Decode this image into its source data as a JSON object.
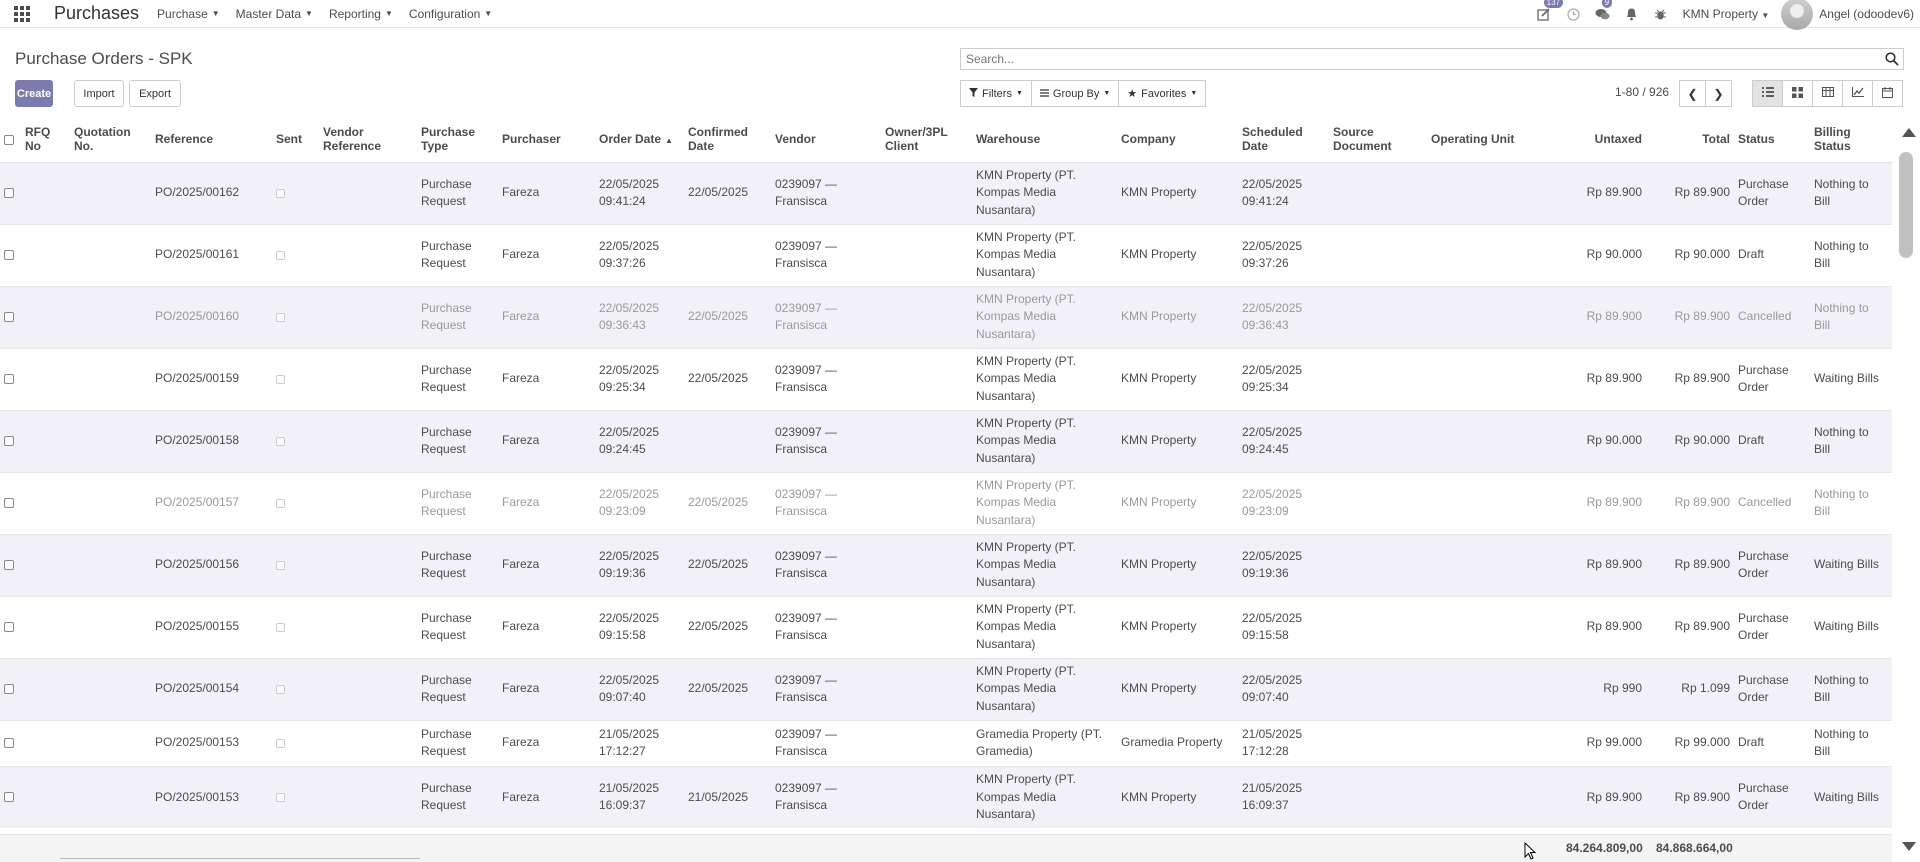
{
  "navbar": {
    "app_title": "Purchases",
    "menus": [
      "Purchase",
      "Master Data",
      "Reporting",
      "Configuration"
    ],
    "activity_badge": "137",
    "messages_badge": "9",
    "company": "KMN Property",
    "user": "Angel (odoodev6)"
  },
  "control_panel": {
    "title": "Purchase Orders - SPK",
    "create_label": "Create",
    "import_label": "Import",
    "export_label": "Export",
    "search_placeholder": "Search...",
    "filters_label": "Filters",
    "group_by_label": "Group By",
    "favorites_label": "Favorites",
    "pager": "1-80 / 926"
  },
  "table": {
    "columns": [
      "RFQ No",
      "Quotation No.",
      "Reference",
      "Sent",
      "Vendor Reference",
      "Purchase Type",
      "Purchaser",
      "Order Date",
      "Confirmed Date",
      "Vendor",
      "Owner/3PL Client",
      "Warehouse",
      "Company",
      "Scheduled Date",
      "Source Document",
      "Operating Unit",
      "Untaxed",
      "Total",
      "Status",
      "Billing Status"
    ],
    "rows": [
      {
        "ref": "PO/2025/00162",
        "ptype": "Purchase Request",
        "purchaser": "Fareza",
        "order_date": "22/05/2025 09:41:24",
        "confirmed": "22/05/2025",
        "vendor": "0239097 — Fransisca",
        "warehouse": "KMN Property (PT. Kompas Media Nusantara)",
        "company": "KMN Property",
        "scheduled": "22/05/2025 09:41:24",
        "untaxed": "Rp 89.900",
        "total": "Rp 89.900",
        "status": "Purchase Order",
        "billing": "Nothing to Bill"
      },
      {
        "ref": "PO/2025/00161",
        "ptype": "Purchase Request",
        "purchaser": "Fareza",
        "order_date": "22/05/2025 09:37:26",
        "confirmed": "",
        "vendor": "0239097 — Fransisca",
        "warehouse": "KMN Property (PT. Kompas Media Nusantara)",
        "company": "KMN Property",
        "scheduled": "22/05/2025 09:37:26",
        "untaxed": "Rp 90.000",
        "total": "Rp 90.000",
        "status": "Draft",
        "billing": "Nothing to Bill"
      },
      {
        "ref": "PO/2025/00160",
        "ptype": "Purchase Request",
        "purchaser": "Fareza",
        "order_date": "22/05/2025 09:36:43",
        "confirmed": "22/05/2025",
        "vendor": "0239097 — Fransisca",
        "warehouse": "KMN Property (PT. Kompas Media Nusantara)",
        "company": "KMN Property",
        "scheduled": "22/05/2025 09:36:43",
        "untaxed": "Rp 89.900",
        "total": "Rp 89.900",
        "status": "Cancelled",
        "billing": "Nothing to Bill"
      },
      {
        "ref": "PO/2025/00159",
        "ptype": "Purchase Request",
        "purchaser": "Fareza",
        "order_date": "22/05/2025 09:25:34",
        "confirmed": "22/05/2025",
        "vendor": "0239097 — Fransisca",
        "warehouse": "KMN Property (PT. Kompas Media Nusantara)",
        "company": "KMN Property",
        "scheduled": "22/05/2025 09:25:34",
        "untaxed": "Rp 89.900",
        "total": "Rp 89.900",
        "status": "Purchase Order",
        "billing": "Waiting Bills"
      },
      {
        "ref": "PO/2025/00158",
        "ptype": "Purchase Request",
        "purchaser": "Fareza",
        "order_date": "22/05/2025 09:24:45",
        "confirmed": "",
        "vendor": "0239097 — Fransisca",
        "warehouse": "KMN Property (PT. Kompas Media Nusantara)",
        "company": "KMN Property",
        "scheduled": "22/05/2025 09:24:45",
        "untaxed": "Rp 90.000",
        "total": "Rp 90.000",
        "status": "Draft",
        "billing": "Nothing to Bill"
      },
      {
        "ref": "PO/2025/00157",
        "ptype": "Purchase Request",
        "purchaser": "Fareza",
        "order_date": "22/05/2025 09:23:09",
        "confirmed": "22/05/2025",
        "vendor": "0239097 — Fransisca",
        "warehouse": "KMN Property (PT. Kompas Media Nusantara)",
        "company": "KMN Property",
        "scheduled": "22/05/2025 09:23:09",
        "untaxed": "Rp 89.900",
        "total": "Rp 89.900",
        "status": "Cancelled",
        "billing": "Nothing to Bill"
      },
      {
        "ref": "PO/2025/00156",
        "ptype": "Purchase Request",
        "purchaser": "Fareza",
        "order_date": "22/05/2025 09:19:36",
        "confirmed": "22/05/2025",
        "vendor": "0239097 — Fransisca",
        "warehouse": "KMN Property (PT. Kompas Media Nusantara)",
        "company": "KMN Property",
        "scheduled": "22/05/2025 09:19:36",
        "untaxed": "Rp 89.900",
        "total": "Rp 89.900",
        "status": "Purchase Order",
        "billing": "Waiting Bills"
      },
      {
        "ref": "PO/2025/00155",
        "ptype": "Purchase Request",
        "purchaser": "Fareza",
        "order_date": "22/05/2025 09:15:58",
        "confirmed": "22/05/2025",
        "vendor": "0239097 — Fransisca",
        "warehouse": "KMN Property (PT. Kompas Media Nusantara)",
        "company": "KMN Property",
        "scheduled": "22/05/2025 09:15:58",
        "untaxed": "Rp 89.900",
        "total": "Rp 89.900",
        "status": "Purchase Order",
        "billing": "Waiting Bills"
      },
      {
        "ref": "PO/2025/00154",
        "ptype": "Purchase Request",
        "purchaser": "Fareza",
        "order_date": "22/05/2025 09:07:40",
        "confirmed": "22/05/2025",
        "vendor": "0239097 — Fransisca",
        "warehouse": "KMN Property (PT. Kompas Media Nusantara)",
        "company": "KMN Property",
        "scheduled": "22/05/2025 09:07:40",
        "untaxed": "Rp 990",
        "total": "Rp 1.099",
        "status": "Purchase Order",
        "billing": "Nothing to Bill"
      },
      {
        "ref": "PO/2025/00153",
        "ptype": "Purchase Request",
        "purchaser": "Fareza",
        "order_date": "21/05/2025 17:12:27",
        "confirmed": "",
        "vendor": "0239097 — Fransisca",
        "warehouse": "Gramedia Property (PT. Gramedia)",
        "company": "Gramedia Property",
        "scheduled": "21/05/2025 17:12:28",
        "untaxed": "Rp 99.000",
        "total": "Rp 99.000",
        "status": "Draft",
        "billing": "Nothing to Bill"
      },
      {
        "ref": "PO/2025/00153",
        "ptype": "Purchase Request",
        "purchaser": "Fareza",
        "order_date": "21/05/2025 16:09:37",
        "confirmed": "21/05/2025",
        "vendor": "0239097 — Fransisca",
        "warehouse": "KMN Property (PT. Kompas Media Nusantara)",
        "company": "KMN Property",
        "scheduled": "21/05/2025 16:09:37",
        "untaxed": "Rp 89.900",
        "total": "Rp 89.900",
        "status": "Purchase Order",
        "billing": "Waiting Bills"
      }
    ],
    "totals": {
      "untaxed": "84.264.809,00",
      "total": "84.868.664,00"
    }
  },
  "colors": {
    "brand": "#7c7bad",
    "row_stripe": "#f1f1f7",
    "muted_text": "#999999"
  }
}
